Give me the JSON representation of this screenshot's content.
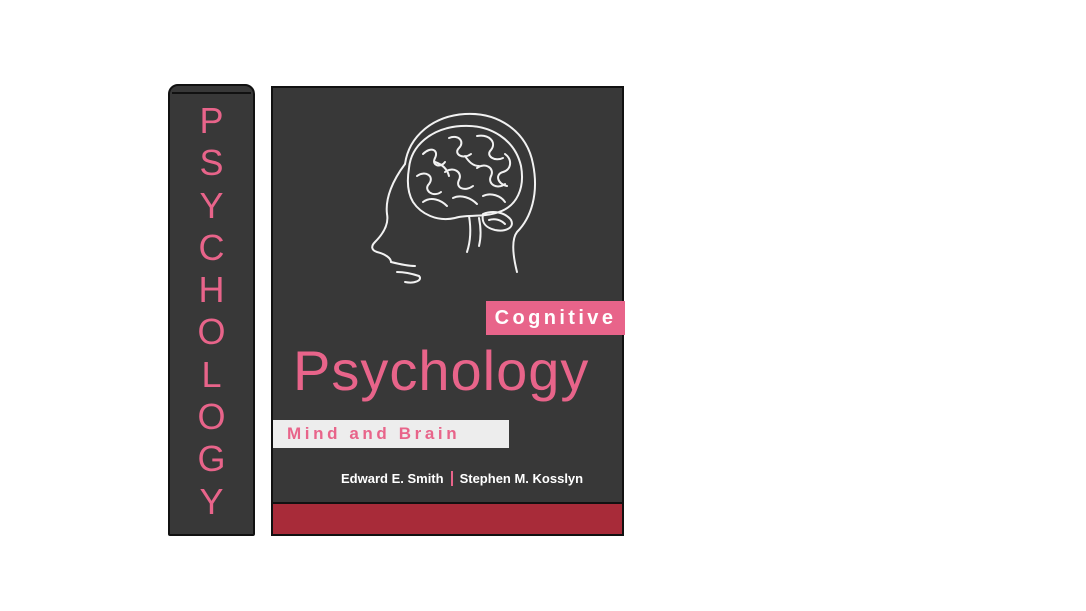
{
  "colors": {
    "accent_pink": "#e8648a",
    "cover_dark": "#383838",
    "band_red": "#a82b39",
    "tagline_bg": "#ededed"
  },
  "spine": {
    "letters": [
      "P",
      "S",
      "Y",
      "C",
      "H",
      "O",
      "L",
      "O",
      "G",
      "Y"
    ]
  },
  "cover": {
    "illustration_icon": "brain-head-profile-icon",
    "subtitle": "Cognitive",
    "title": "Psychology",
    "tagline": "Mind and Brain",
    "authors": [
      "Edward E. Smith",
      "Stephen M. Kosslyn"
    ]
  }
}
